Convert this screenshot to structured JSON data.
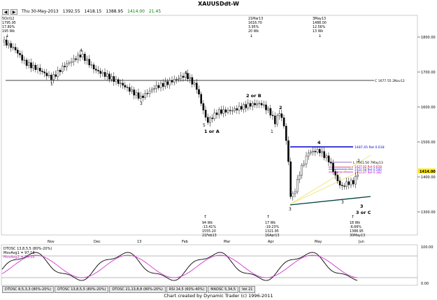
{
  "window": {
    "title": "XAUUSDdt-W",
    "toolbar": {
      "date": "Thu 30-May-2013",
      "open": "1392.55",
      "high": "1418.15",
      "low": "1388.95",
      "close": "1414.00",
      "change": "21.45"
    },
    "credit": "Chart created by Dynamic Trader  (c) 1996-2011"
  },
  "price_axis": {
    "ticks": [
      "1800.00",
      "1700.00",
      "1600.00",
      "1500.00",
      "1400.00",
      "1300.00"
    ],
    "current": "1414.00"
  },
  "date_axis": [
    "Nov",
    "Dec",
    "13",
    "Feb",
    "Mar",
    "Apr",
    "May",
    "Jun"
  ],
  "osc_axis": {
    "ticks": [
      "100.00",
      "0.00"
    ]
  },
  "annotations": {
    "top_left": [
      "5Oct12",
      "1795.95",
      "17.80%",
      "195 Wk"
    ],
    "top_mid": [
      "21Mar13",
      "1616.70",
      "3.95%",
      "20 Wk"
    ],
    "top_right": [
      "3May13",
      "1488.00",
      "12.56%",
      "13 Wk"
    ],
    "bot_1": [
      "94 Wk",
      "-13.41%",
      "1555.20",
      "21Feb13"
    ],
    "bot_2": [
      "17 Wk",
      "-19.23%",
      "1321.95",
      "16Apr13"
    ],
    "bot_3": [
      "18 Wk",
      "-6.66%",
      "1388.95",
      "30May13"
    ],
    "wave_labels": {
      "w4a": "4",
      "w3": "3",
      "w1a": "1 or A",
      "w2b": "2 or B",
      "w2": "2",
      "w1": "1",
      "w3b": "3",
      "w4b": "4",
      "w5": "5",
      "w3c": "3 or C",
      "w4c": "4",
      "w3d": "3",
      "w3e": "3",
      "w1b": "1",
      "w2c": "2"
    },
    "c_line": "C 1677.55 2Nov12",
    "ret_line": "1487.45 Ret 0.618",
    "ext_line": "L 1441.50 7May13",
    "cluster_1": "1427.02 Ret 0.618",
    "cluster_2": "1422.68 Ret 0.500",
    "cluster_3": "1413.07 Ret 0.382"
  },
  "oscillator": {
    "label": "DTOSC 13,8,5,5 (80%-20%)",
    "line1": "MovAvg1 = 97.13",
    "line2": "MovAvg2 = 74.59"
  },
  "tabs": [
    "DTOSC 8,5,3,3 (80%-20%)",
    "DTOSC 13,8,5,5 (80%-20%)",
    "DTOSC 21,13,8,8 (80%-20%)",
    "RSI 14,5 (60%-40%)",
    "MAOSC 5,34,5",
    "Vol 21"
  ],
  "colors": {
    "candle": "#000000",
    "blue_line": "#0000cc",
    "ext_line": "#6a3fb3",
    "ret_618": "#cc0033",
    "ret_500": "#1a1aff",
    "ret_382": "#cc00cc",
    "fan": "#f2e27a",
    "osc_black": "#000000",
    "osc_magenta": "#cc33cc",
    "price_highlight": "#ffea00"
  }
}
